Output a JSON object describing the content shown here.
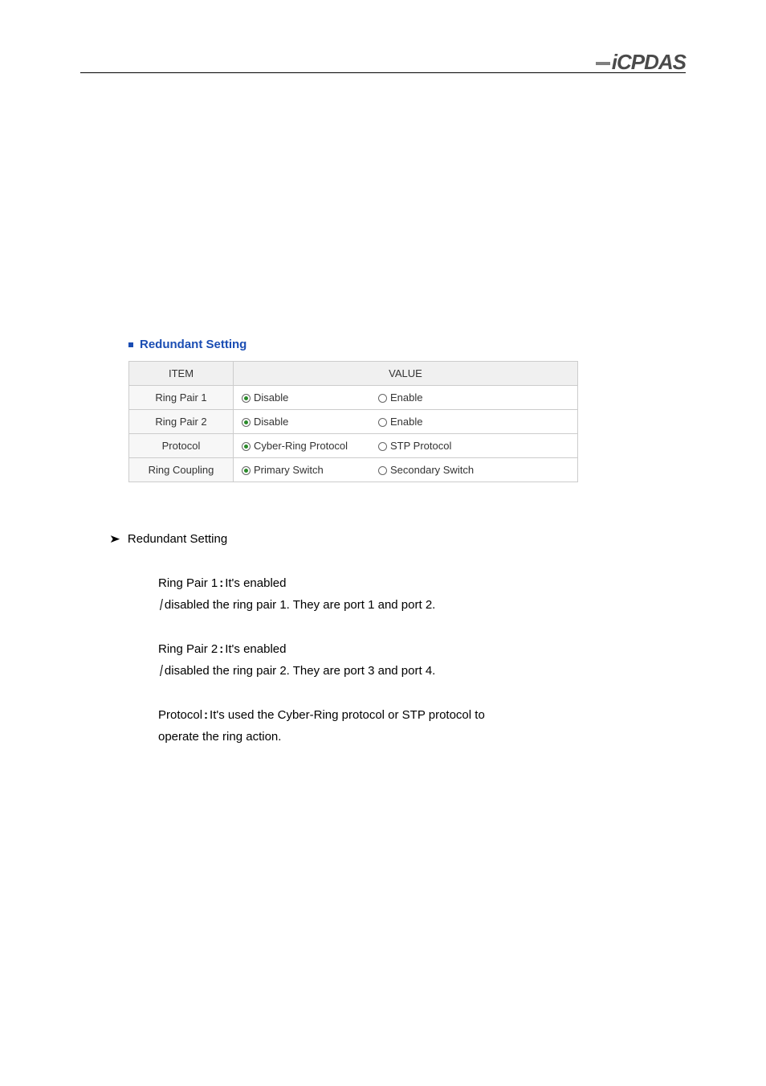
{
  "logo": {
    "text": "iCPDAS"
  },
  "panel": {
    "title": "Redundant Setting",
    "headers": {
      "item": "ITEM",
      "value": "VALUE"
    },
    "rows": [
      {
        "item": "Ring Pair 1",
        "opt1": {
          "label": "Disable",
          "checked": true,
          "name": "ring-pair-1-disable-radio"
        },
        "opt2": {
          "label": "Enable",
          "checked": false,
          "name": "ring-pair-1-enable-radio"
        }
      },
      {
        "item": "Ring Pair 2",
        "opt1": {
          "label": "Disable",
          "checked": true,
          "name": "ring-pair-2-disable-radio"
        },
        "opt2": {
          "label": "Enable",
          "checked": false,
          "name": "ring-pair-2-enable-radio"
        }
      },
      {
        "item": "Protocol",
        "opt1": {
          "label": "Cyber-Ring Protocol",
          "checked": true,
          "name": "protocol-cyberring-radio"
        },
        "opt2": {
          "label": "STP Protocol",
          "checked": false,
          "name": "protocol-stp-radio"
        }
      },
      {
        "item": "Ring Coupling",
        "opt1": {
          "label": "Primary Switch",
          "checked": true,
          "name": "ring-coupling-primary-radio"
        },
        "opt2": {
          "label": "Secondary Switch",
          "checked": false,
          "name": "ring-coupling-secondary-radio"
        }
      }
    ]
  },
  "section": {
    "heading": "Redundant Setting",
    "defs": [
      {
        "label": "Ring Pair 1",
        "name": "def-ring-pair-1",
        "lines": [
          "It's enabled",
          "disabled the ring pair 1. They are port 1 and port 2."
        ]
      },
      {
        "label": "Ring Pair 2",
        "name": "def-ring-pair-2",
        "lines": [
          "It's enabled",
          "disabled the ring pair 2. They are port 3 and port 4."
        ]
      },
      {
        "label": "Protocol",
        "name": "def-protocol",
        "lines": [
          "It's used the Cyber-Ring protocol or STP protocol to"
        ],
        "cont": "operate the ring action."
      }
    ]
  }
}
